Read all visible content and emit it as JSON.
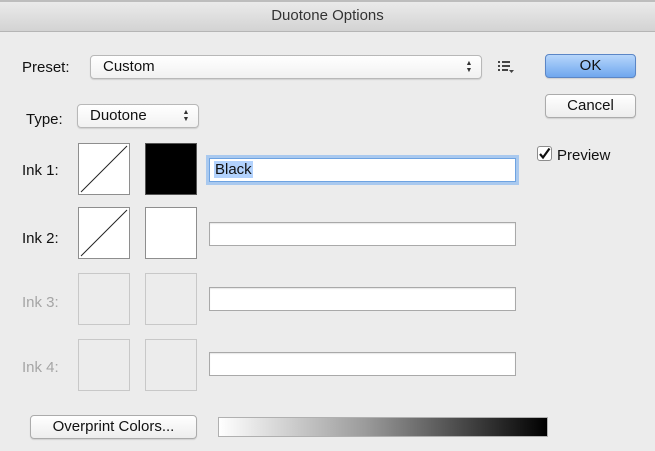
{
  "window": {
    "title": "Duotone Options"
  },
  "preset": {
    "label": "Preset:",
    "value": "Custom"
  },
  "type": {
    "label": "Type:",
    "value": "Duotone"
  },
  "buttons": {
    "ok": "OK",
    "cancel": "Cancel",
    "overprint": "Overprint Colors..."
  },
  "preview": {
    "label": "Preview",
    "checked": true
  },
  "inks": [
    {
      "label": "Ink 1:",
      "name": "Black",
      "enabled": true
    },
    {
      "label": "Ink 2:",
      "name": "",
      "enabled": true
    },
    {
      "label": "Ink 3:",
      "name": "",
      "enabled": false
    },
    {
      "label": "Ink 4:",
      "name": "",
      "enabled": false
    }
  ],
  "colors": {
    "accent": "#6fa7ee",
    "ink1_swatch": "#000000",
    "ink2_swatch": "#ffffff"
  },
  "icons": {
    "preset_menu": "list-menu-icon",
    "popup_arrows": "up-down-arrows-icon",
    "curve": "diagonal-curve-icon",
    "check": "checkmark-icon"
  }
}
